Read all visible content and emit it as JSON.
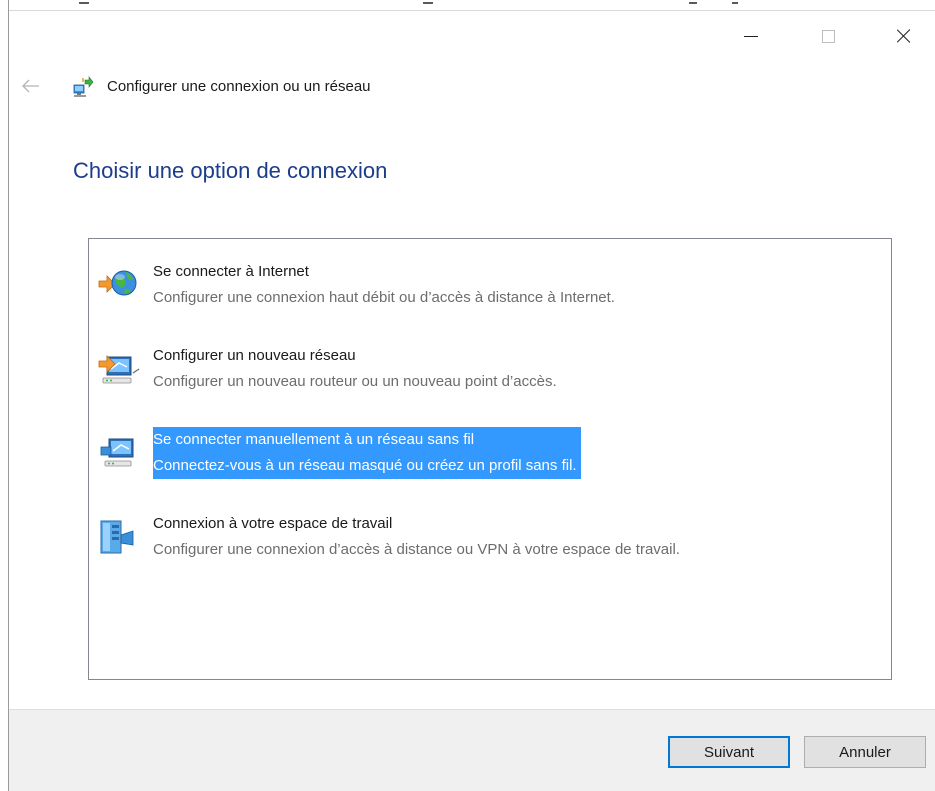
{
  "window": {
    "title": "Configurer une connexion ou un réseau",
    "buttons": {
      "minimize": "minimize",
      "maximize": "maximize",
      "close": "close"
    }
  },
  "header": {
    "back_icon": "back-arrow-icon",
    "title": "Configurer une connexion ou un réseau"
  },
  "page": {
    "heading": "Choisir une option de connexion"
  },
  "options": [
    {
      "title": "Se connecter à Internet",
      "description": "Configurer une connexion haut débit ou d’accès à distance à Internet.",
      "icon": "internet-globe-icon",
      "selected": false
    },
    {
      "title": "Configurer un nouveau réseau",
      "description": "Configurer un nouveau routeur ou un nouveau point d’accès.",
      "icon": "new-network-router-icon",
      "selected": false
    },
    {
      "title": "Se connecter manuellement à un réseau sans fil",
      "description": "Connectez-vous à un réseau masqué ou créez un profil sans fil.",
      "icon": "wireless-network-icon",
      "selected": true
    },
    {
      "title": "Connexion à votre espace de travail",
      "description": "Configurer une connexion d’accès à distance ou VPN à votre espace de travail.",
      "icon": "workplace-vpn-icon",
      "selected": false
    }
  ],
  "footer": {
    "next_label": "Suivant",
    "cancel_label": "Annuler"
  },
  "colors": {
    "heading": "#1c3d8c",
    "selection": "#3399ff",
    "footer_bg": "#f0f0f0",
    "default_button_border": "#0078d7"
  }
}
